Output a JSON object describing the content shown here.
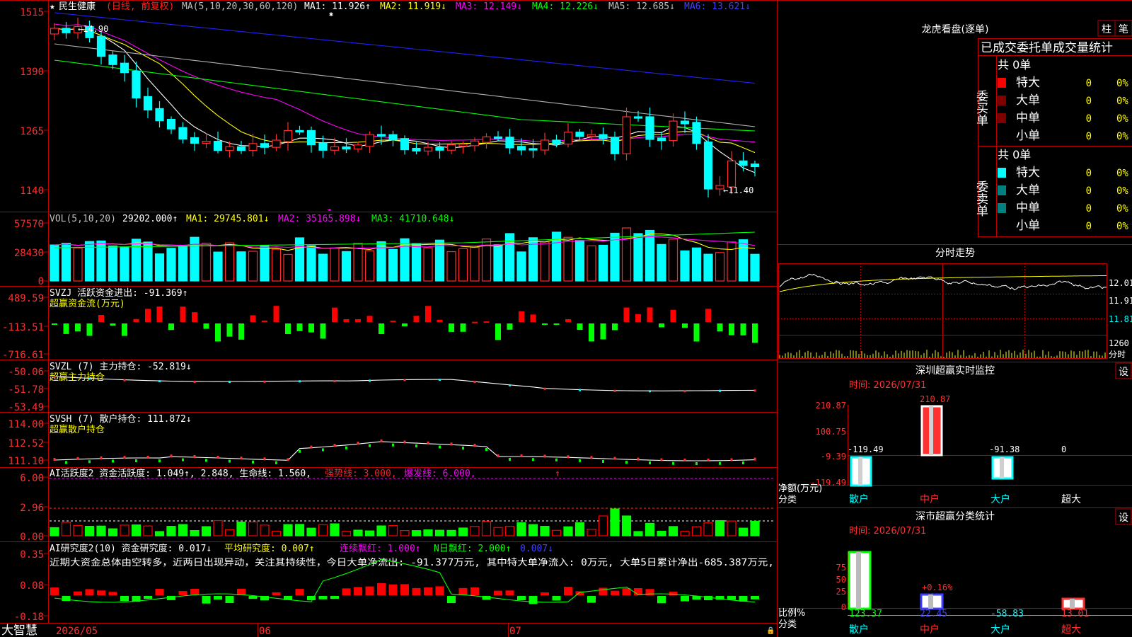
{
  "colors": {
    "up": "#ff2a2a",
    "down": "#00ffff",
    "red": "#ff0000",
    "green": "#00ff00",
    "yellow": "#ffff00",
    "magenta": "#ff00ff",
    "white": "#ffffff",
    "blue": "#2020ff",
    "gray": "#b0b0b0",
    "grid": "#c00000",
    "axis_text": "#ff3030"
  },
  "header": {
    "star": "★",
    "stock_name": "民生健康",
    "mode": "(日线, 前复权)",
    "ma_params": "MA(5,10,20,30,60,120)",
    "ma1": "MA1: 11.926↑",
    "ma2": "MA2: 11.919↓",
    "ma3": "MA3: 12.149↓",
    "ma4": "MA4: 12.226↓",
    "ma5": "MA5: 12.685↓",
    "ma6": "MA6: 13.621↓"
  },
  "price_axis": [
    "1515",
    "1390",
    "1265",
    "1140"
  ],
  "price_marks": {
    "high": "14.90",
    "low": "←11.40"
  },
  "vol": {
    "label": "VOL(5,10,20)",
    "v": "29202.000↑",
    "ma1": "MA1: 29745.801↓",
    "ma2": "MA2: 35165.898↓",
    "ma3": "MA3: 41710.648↓",
    "axis": [
      "57570",
      "28430",
      "0"
    ]
  },
  "svzj": {
    "label": "SVZJ  活跃资金进出: -91.369↑",
    "sub": "超赢资金流(万元)",
    "axis": [
      "489.59",
      "-113.51",
      "-716.61"
    ]
  },
  "svzl": {
    "label": "SVZL (7) 主力持仓: -52.819↓",
    "sub": "超赢主力持仓",
    "axis": [
      "-50.06",
      "-51.78",
      "-53.49"
    ]
  },
  "svsh": {
    "label": "SVSH (7) 散户持仓: 111.872↓",
    "sub": "超赢散户持仓",
    "axis": [
      "114.00",
      "112.52",
      "111.10"
    ]
  },
  "ai1": {
    "label": "AI活跃度2 资金活跃度: 1.049↑, 2.848, 生命线: 1.560,",
    "strong": "强势线: 3.000,",
    "burst": "爆发线: 6.000,",
    "axis": [
      "6.00",
      "2.96",
      "0.00"
    ]
  },
  "ai2": {
    "label": "AI研究度2(10) 资金研究度: 0.017↓",
    "avg": "平均研究度: 0.007↑",
    "red": "连续飘红: 1.000↑",
    "nred": "N日飘红: 2.000↑",
    "last": "0.007↓",
    "comment": "近期大资金总体由空转多，近两日出现异动，关注其持续性，今日大单净流出: -91.377万元, 其中特大单净流入: 0万元, 大单5日累计净出-685.387万元,",
    "axis": [
      "0.35",
      "0.08",
      "-0.18"
    ]
  },
  "bottom": {
    "brand": "大智慧",
    "dates": [
      "2026/05",
      "06",
      "07"
    ]
  },
  "right": {
    "title": "龙虎看盘(逐单)",
    "btn1": "柱",
    "btn2": "笔",
    "table_title": "已成交委托单成交量统计",
    "buy_label": "委买单",
    "sell_label": "委卖单",
    "buy_total": "共 0单",
    "sell_total": "共 0单",
    "rows": [
      {
        "name": "特大",
        "val": "0",
        "pct": "0%"
      },
      {
        "name": "大单",
        "val": "0",
        "pct": "0%"
      },
      {
        "name": "中单",
        "val": "0",
        "pct": "0%"
      },
      {
        "name": "小单",
        "val": "0",
        "pct": "0%"
      }
    ],
    "intraday_title": "分时走势",
    "intraday_axis": [
      "12.01",
      "11.91",
      "11.81"
    ],
    "intraday_vol": "1260",
    "intraday_vol_label": "分时",
    "monitor_title": "深圳超赢实时监控",
    "monitor_btn": "设",
    "monitor_time": "时间: 2026/07/31",
    "monitor_axis": [
      "210.87",
      "100.75",
      "-9.39",
      "-119.49"
    ],
    "monitor_top": "210.87",
    "monitor_vals": [
      "-119.49",
      "-91.38",
      "0"
    ],
    "monitor_net": "净额(万元)",
    "monitor_cat": "分类",
    "cats": [
      "散户",
      "中户",
      "大户",
      "超大"
    ],
    "class_title": "深市超赢分类统计",
    "class_btn": "设",
    "class_time": "时间: 2026/07/31",
    "class_axis": [
      "75",
      "50",
      "25",
      "0"
    ],
    "class_ratio": "比例%",
    "class_cat": "分类",
    "class_vals": [
      "123.37",
      "22.45",
      "-58.83",
      "13.01"
    ],
    "class_mid": "+0.16%"
  }
}
